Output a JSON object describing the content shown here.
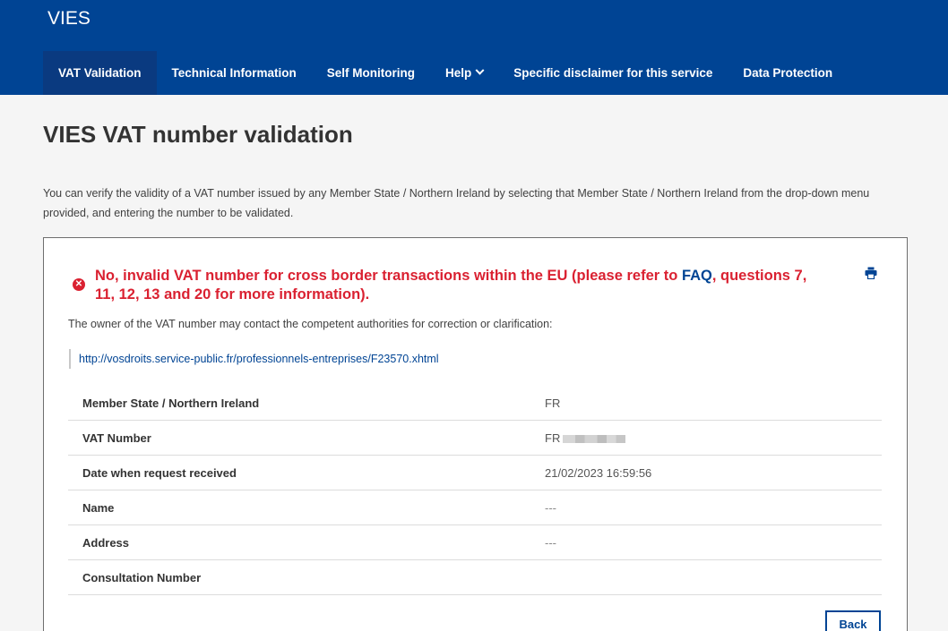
{
  "app": {
    "title": "VIES"
  },
  "nav": {
    "items": [
      {
        "label": "VAT Validation",
        "active": true
      },
      {
        "label": "Technical Information"
      },
      {
        "label": "Self Monitoring"
      },
      {
        "label": "Help"
      },
      {
        "label": "Specific disclaimer for this service"
      },
      {
        "label": "Data Protection"
      }
    ]
  },
  "page": {
    "title": "VIES VAT number validation",
    "intro": "You can verify the validity of a VAT number issued by any Member State / Northern Ireland by selecting that Member State / Northern Ireland from the drop-down menu provided, and entering the number to be validated."
  },
  "result": {
    "error_part1": "No, invalid VAT number for cross border transactions within the EU (please refer to ",
    "faq_link": "FAQ",
    "error_part2": ", questions 7, 11, 12, 13 and 20 for more information).",
    "owner_text": "The owner of the VAT number may contact the competent authorities for correction or clarification:",
    "authority_link": "http://vosdroits.service-public.fr/professionnels-entreprises/F23570.xhtml",
    "details": [
      {
        "label": "Member State / Northern Ireland",
        "value": "FR"
      },
      {
        "label": "VAT Number",
        "value": "FR"
      },
      {
        "label": "Date when request received",
        "value": "21/02/2023 16:59:56"
      },
      {
        "label": "Name",
        "value": "---"
      },
      {
        "label": "Address",
        "value": "---"
      },
      {
        "label": "Consultation Number",
        "value": ""
      }
    ],
    "back_label": "Back"
  },
  "colors": {
    "brand": "#004494",
    "error": "#da2131"
  },
  "icons": {
    "error": "error-circle-icon",
    "print": "print-icon",
    "help_dropdown": "chevron-down-icon"
  }
}
